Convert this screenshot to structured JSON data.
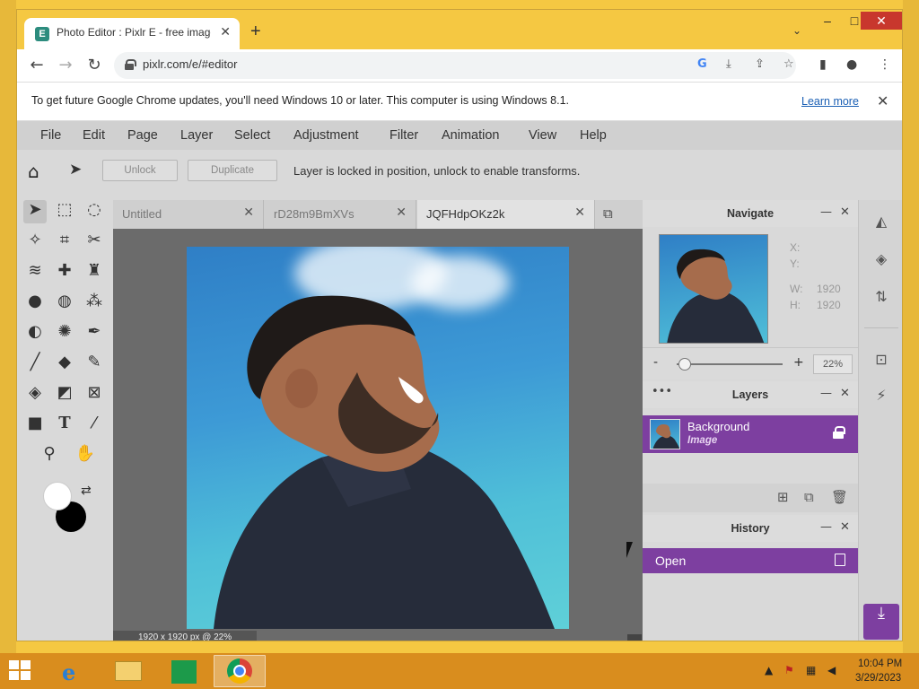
{
  "browser": {
    "tab_title": "Photo Editor : Pixlr E - free image",
    "tab_favicon": "E",
    "url": "pixlr.com/e/#editor",
    "infobar_text": "To get future Google Chrome updates, you'll need Windows 10 or later. This computer is using Windows 8.1.",
    "infobar_link": "Learn more"
  },
  "menu": [
    "File",
    "Edit",
    "Page",
    "Layer",
    "Select",
    "Adjustment",
    "Filter",
    "Animation",
    "View",
    "Help"
  ],
  "options_bar": {
    "unlock_label": "Unlock",
    "duplicate_label": "Duplicate",
    "message": "Layer is locked in position, unlock to enable transforms."
  },
  "doc_tabs": [
    {
      "label": "Untitled",
      "active": false
    },
    {
      "label": "rD28m9BmXVs",
      "active": false
    },
    {
      "label": "JQFHdpOKz2k",
      "active": true
    }
  ],
  "canvas_status": "1920 x 1920 px @ 22%",
  "navigate": {
    "title": "Navigate",
    "x_label": "X:",
    "y_label": "Y:",
    "w_label": "W:",
    "w_value": "1920",
    "h_label": "H:",
    "h_value": "1920",
    "zoom_value": "22%"
  },
  "layers": {
    "title": "Layers",
    "items": [
      {
        "name": "Background",
        "type": "Image"
      }
    ]
  },
  "history": {
    "title": "History",
    "items": [
      "Open"
    ]
  },
  "taskbar": {
    "time": "10:04 PM",
    "date": "3/29/2023"
  },
  "colors": {
    "accent": "#7d3fa0",
    "desktop": "#f5c842",
    "taskbar": "#d98d1e"
  }
}
